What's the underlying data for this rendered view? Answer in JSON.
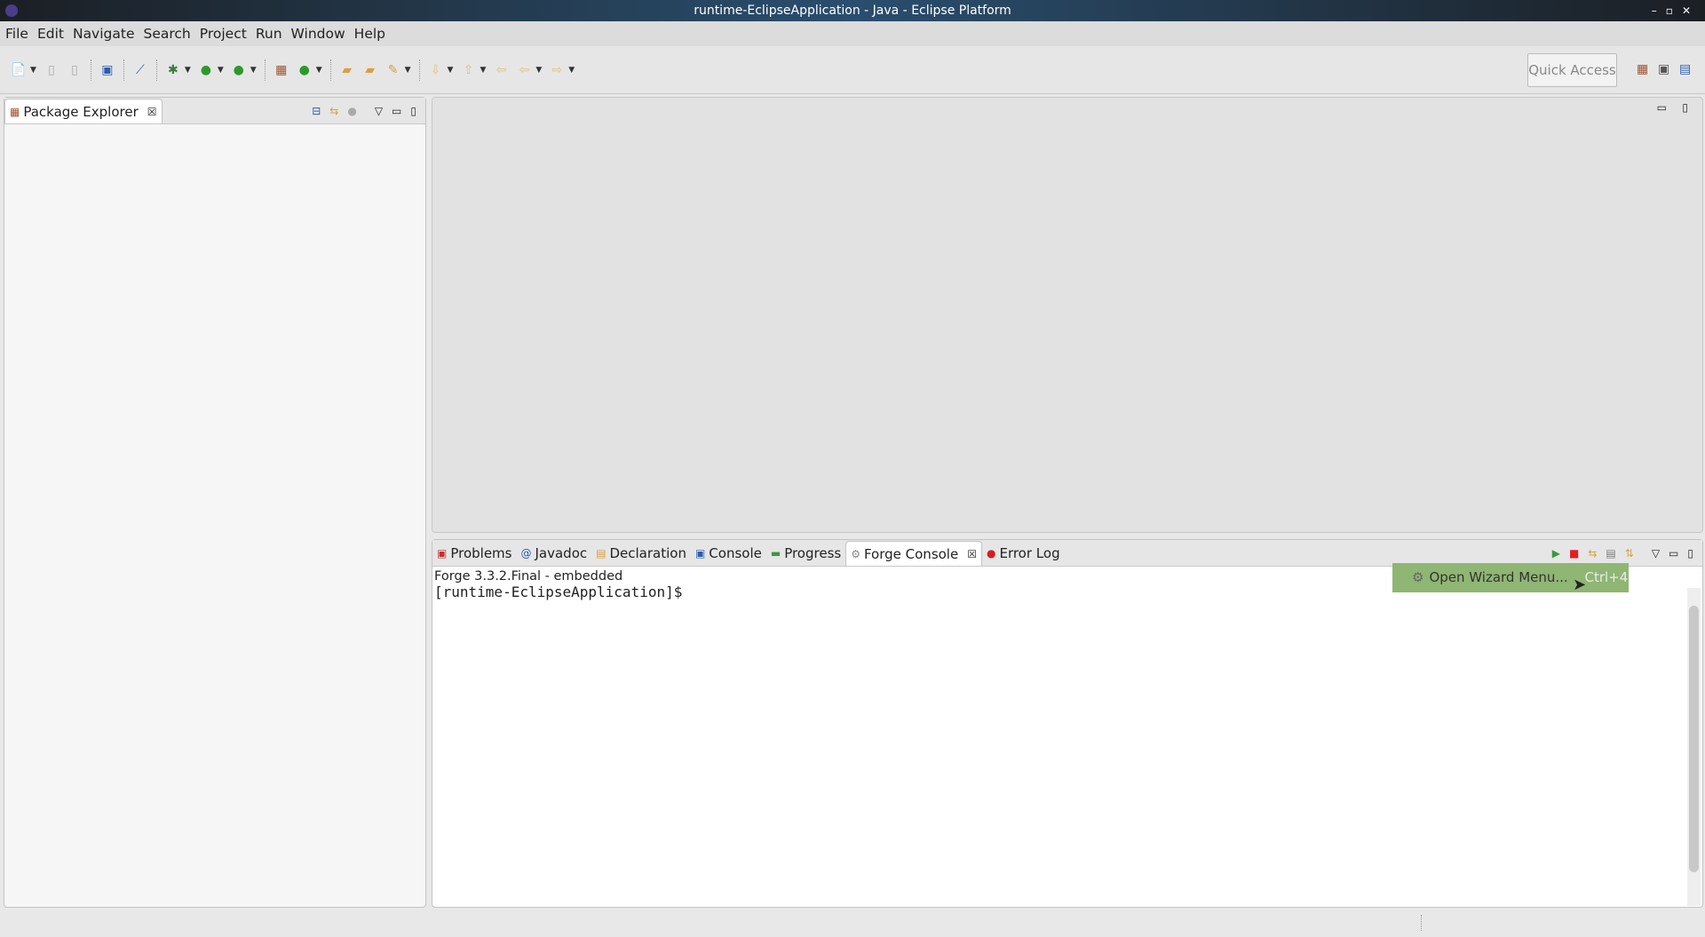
{
  "window": {
    "title": "runtime-EclipseApplication - Java - Eclipse Platform"
  },
  "menu": [
    "File",
    "Edit",
    "Navigate",
    "Search",
    "Project",
    "Run",
    "Window",
    "Help"
  ],
  "toolbar": {
    "quick_access": "Quick Access"
  },
  "package_explorer": {
    "tab": "Package Explorer"
  },
  "bottom": {
    "tabs": [
      "Problems",
      "Javadoc",
      "Declaration",
      "Console",
      "Progress",
      "Forge Console",
      "Error Log"
    ],
    "console_lines": [
      "Forge 3.3.2.Final - embedded",
      "[runtime-EclipseApplication]$"
    ],
    "tooltip": {
      "label": "Open Wizard Menu...",
      "shortcut": "Ctrl+4"
    }
  },
  "colors": {
    "tooltip": "#8fb673",
    "titlebar": "#2a4e6e"
  }
}
